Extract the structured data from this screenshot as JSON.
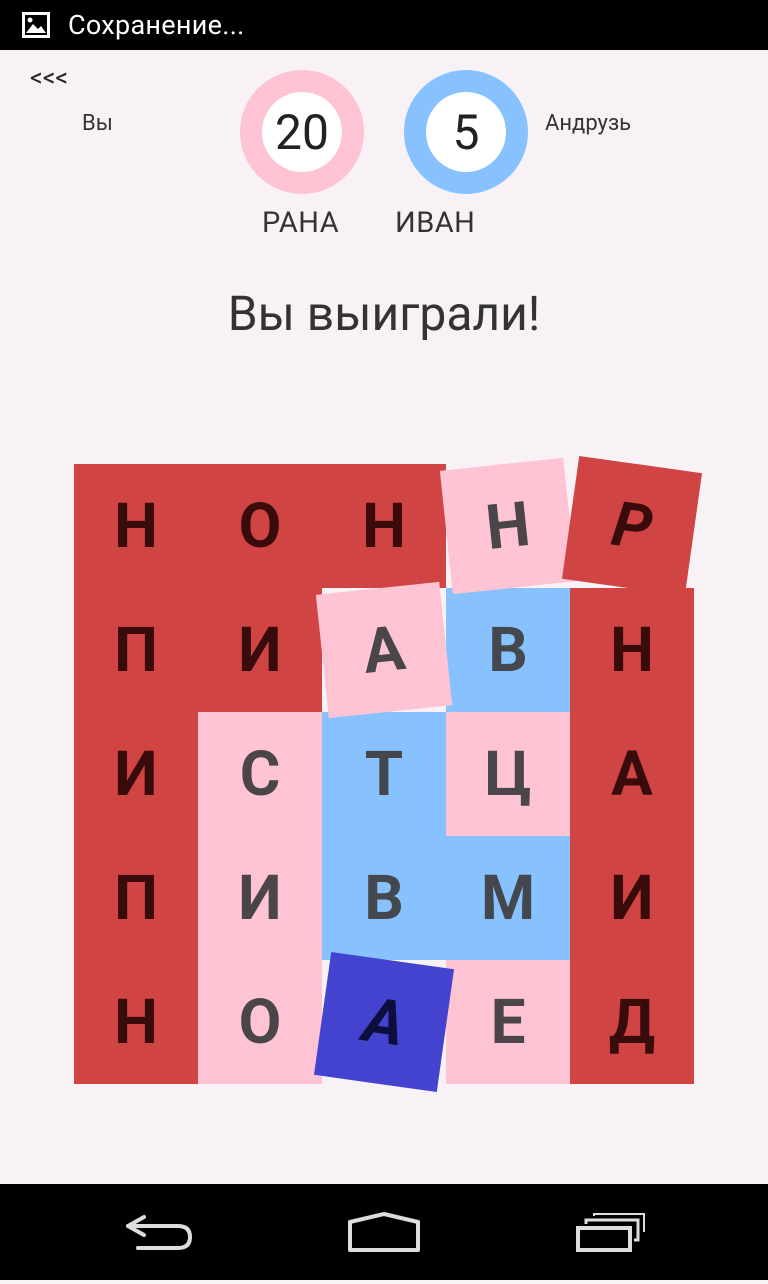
{
  "statusbar": {
    "text": "Сохранение..."
  },
  "header": {
    "back": "<<<",
    "you_label": "Вы",
    "opponent_label": "Андрузь",
    "player1": {
      "name": "РАНА",
      "score": "20",
      "color": "#ffc4d3"
    },
    "player2": {
      "name": "ИВАН",
      "score": "5",
      "color": "#87c2ff"
    }
  },
  "result": "Вы выиграли!",
  "colors": {
    "red": "#d04444",
    "pink": "#ffc4d3",
    "light_blue": "#87c2ff",
    "dark_blue": "#4343cf",
    "background": "#f8f2f7"
  },
  "board": {
    "rows": [
      [
        "Н",
        "О",
        "Н",
        "Н",
        "Р"
      ],
      [
        "П",
        "И",
        "А",
        "В",
        "Н"
      ],
      [
        "И",
        "С",
        "Т",
        "Ц",
        "А"
      ],
      [
        "П",
        "И",
        "В",
        "М",
        "И"
      ],
      [
        "Н",
        "О",
        "А",
        "Е",
        "Д"
      ]
    ],
    "tile_colors": [
      [
        "red",
        "red",
        "red",
        "pink",
        "red"
      ],
      [
        "red",
        "red",
        "pink",
        "light_blue",
        "red"
      ],
      [
        "red",
        "pink",
        "light_blue",
        "pink",
        "red"
      ],
      [
        "red",
        "pink",
        "light_blue",
        "light_blue",
        "red"
      ],
      [
        "red",
        "pink",
        "dark_blue",
        "pink",
        "red"
      ]
    ]
  },
  "navbar": {
    "icons": [
      "back-icon",
      "home-icon",
      "recent-apps-icon"
    ]
  }
}
